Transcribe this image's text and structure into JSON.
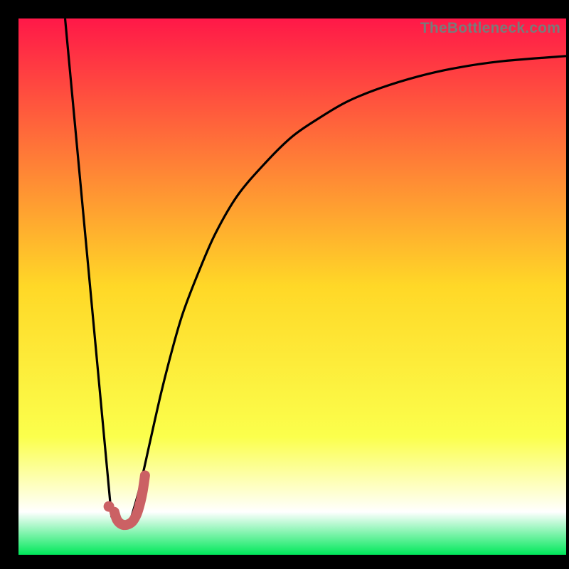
{
  "watermark": "TheBottleneck.com",
  "colors": {
    "bg": "#000000",
    "grad_top": "#ff1848",
    "grad_mid": "#ffd827",
    "grad_low": "#fbff4c",
    "grad_white": "#ffffff",
    "grad_green": "#00e85a",
    "curve": "#000000",
    "marker_stroke": "#cb6164",
    "marker_dot": "#cb6164"
  },
  "chart_data": {
    "type": "line",
    "title": "",
    "xlabel": "",
    "ylabel": "",
    "xlim": [
      0,
      100
    ],
    "ylim": [
      0,
      100
    ],
    "series": [
      {
        "name": "left-branch",
        "x": [
          8.5,
          17.0
        ],
        "values": [
          100,
          7
        ]
      },
      {
        "name": "right-branch",
        "x": [
          20,
          22,
          24,
          26,
          28,
          30,
          33,
          36,
          40,
          45,
          50,
          55,
          60,
          66,
          73,
          80,
          88,
          100
        ],
        "values": [
          5,
          12,
          21,
          30,
          38,
          45,
          53,
          60,
          67,
          73,
          78,
          81.5,
          84.5,
          87,
          89.2,
          90.8,
          92,
          93
        ]
      }
    ],
    "marker": {
      "x": 16.5,
      "y": 9
    },
    "hook": {
      "points_x": [
        17.5,
        18.0,
        18.8,
        19.8,
        20.8,
        21.6,
        22.2,
        22.7,
        23.1
      ],
      "points_y": [
        8.0,
        6.5,
        5.7,
        5.6,
        6.2,
        7.6,
        9.6,
        12.0,
        14.8
      ]
    }
  }
}
